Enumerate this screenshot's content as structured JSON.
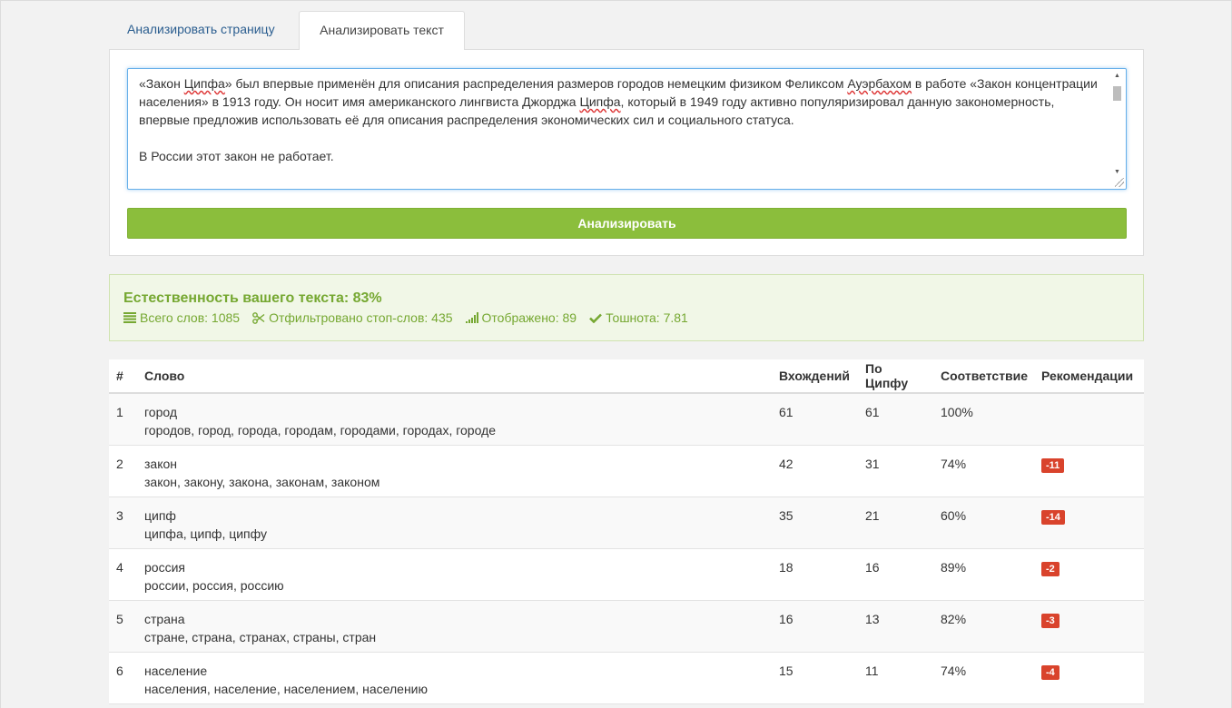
{
  "tabs": [
    {
      "label": "Анализировать страницу",
      "active": false
    },
    {
      "label": "Анализировать текст",
      "active": true
    }
  ],
  "editor": {
    "paragraph1_parts": [
      "«Закон ",
      "Ципфа",
      "» был впервые применён для описания распределения размеров городов немецким физиком Феликсом ",
      "Ауэрбахом",
      " в работе «Закон концентрации населения» в 1913 году. Он носит имя американского лингвиста Джорджа ",
      "Ципфа",
      ", который в 1949 году активно популяризировал данную закономерность, впервые предложив использовать её для описания распределения экономических сил и социального статуса."
    ],
    "paragraph2": "В России этот закон не работает."
  },
  "analyze_button": "Анализировать",
  "result": {
    "title": "Естественность вашего текста: 83%",
    "total_words": "Всего слов: 1085",
    "filtered": "Отфильтровано стоп-слов: 435",
    "shown": "Отображено: 89",
    "nausea": "Тошнота: 7.81",
    "accent_color": "#76a832",
    "badge_color": "#d9432c"
  },
  "table": {
    "headers": [
      "#",
      "Слово",
      "Вхождений",
      "По Ципфу",
      "Соответствие",
      "Рекомендации"
    ],
    "rows": [
      {
        "num": "1",
        "word": "город",
        "forms": "городов, город, города, городам, городами, городах, городе",
        "count": "61",
        "zipf": "61",
        "match": "100%",
        "rec": ""
      },
      {
        "num": "2",
        "word": "закон",
        "forms": "закон, закону, закона, законам, законом",
        "count": "42",
        "zipf": "31",
        "match": "74%",
        "rec": "-11"
      },
      {
        "num": "3",
        "word": "ципф",
        "forms": "ципфа, ципф, ципфу",
        "count": "35",
        "zipf": "21",
        "match": "60%",
        "rec": "-14"
      },
      {
        "num": "4",
        "word": "россия",
        "forms": "россии, россия, россию",
        "count": "18",
        "zipf": "16",
        "match": "89%",
        "rec": "-2"
      },
      {
        "num": "5",
        "word": "страна",
        "forms": "стране, страна, странах, страны, стран",
        "count": "16",
        "zipf": "13",
        "match": "82%",
        "rec": "-3"
      },
      {
        "num": "6",
        "word": "население",
        "forms": "населения, население, населением, населению",
        "count": "15",
        "zipf": "11",
        "match": "74%",
        "rec": "-4"
      }
    ]
  }
}
